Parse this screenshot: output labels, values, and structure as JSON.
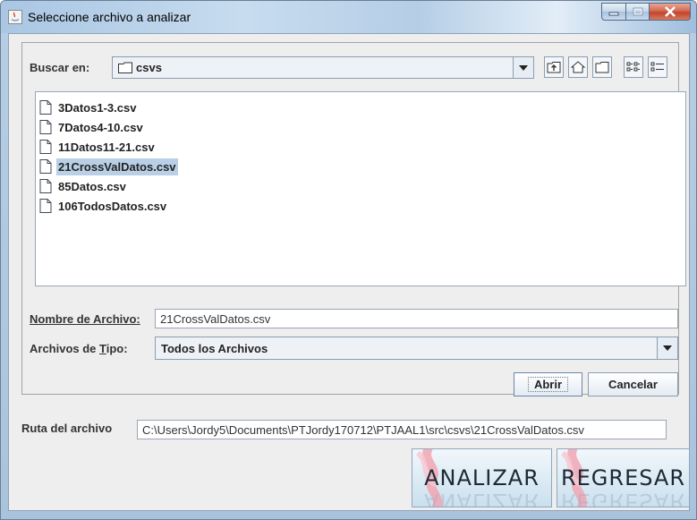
{
  "window": {
    "title": "Seleccione archivo a analizar"
  },
  "chooser": {
    "look_in_label": "Buscar en:",
    "current_folder": "csvs",
    "files": [
      {
        "name": "3Datos1-3.csv",
        "selected": false
      },
      {
        "name": "7Datos4-10.csv",
        "selected": false
      },
      {
        "name": "11Datos11-21.csv",
        "selected": false
      },
      {
        "name": "21CrossValDatos.csv",
        "selected": true
      },
      {
        "name": "85Datos.csv",
        "selected": false
      },
      {
        "name": "106TodosDatos.csv",
        "selected": false
      }
    ],
    "filename_label": "Nombre de Archivo:",
    "filename_value": "21CrossValDatos.csv",
    "filetype_label_pre": "Archivos de ",
    "filetype_label_mnemonic": "T",
    "filetype_label_post": "ipo:",
    "filetype_value": "Todos los Archivos",
    "open_button": "Abrir",
    "cancel_button": "Cancelar"
  },
  "path": {
    "label": "Ruta del archivo",
    "value": "C:\\Users\\Jordy5\\Documents\\PTJordy170712\\PTJAAL1\\src\\csvs\\21CrossValDatos.csv"
  },
  "actions": {
    "analyze_button": "ANALIZAR",
    "back_button": "REGRESAR"
  },
  "colors": {
    "selection": "#b8cfe5",
    "close_button": "#c2432a"
  }
}
